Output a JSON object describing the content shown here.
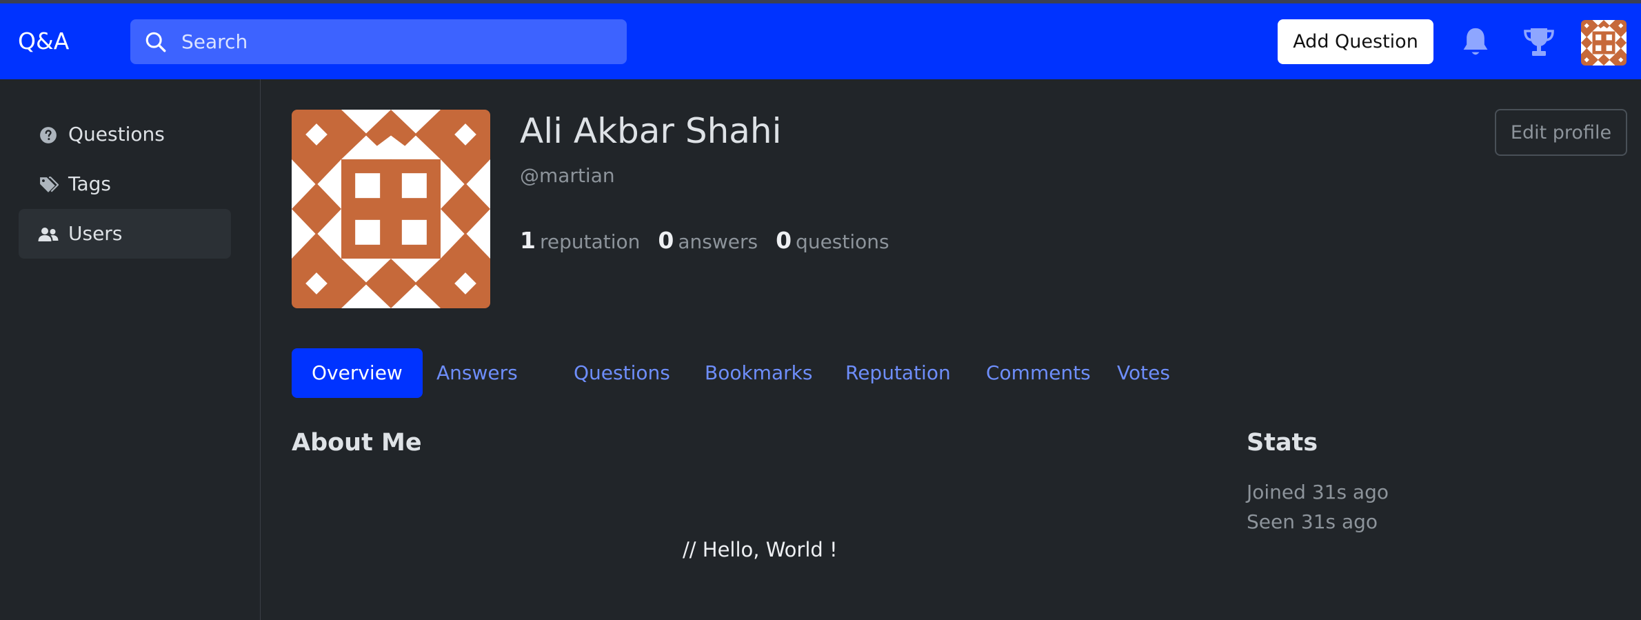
{
  "navbar": {
    "brand": "Q&A",
    "search_placeholder": "Search",
    "add_question_label": "Add Question"
  },
  "sidebar": {
    "items": [
      {
        "label": "Questions",
        "icon": "question-circle-icon"
      },
      {
        "label": "Tags",
        "icon": "tags-icon"
      },
      {
        "label": "Users",
        "icon": "users-icon",
        "active": true
      }
    ]
  },
  "profile": {
    "name": "Ali Akbar Shahi",
    "handle": "@martian",
    "reputation": "1",
    "reputation_label": "reputation",
    "answers": "0",
    "answers_label": "answers",
    "questions": "0",
    "questions_label": "questions",
    "edit_label": "Edit profile",
    "avatar_color": "#c6693a"
  },
  "tabs": [
    "Overview",
    "Answers",
    "Questions",
    "Bookmarks",
    "Reputation",
    "Comments",
    "Votes"
  ],
  "about": {
    "heading": "About Me",
    "text": "// Hello, World !"
  },
  "stats": {
    "heading": "Stats",
    "joined": "Joined 31s ago",
    "seen": "Seen 31s ago"
  },
  "colors": {
    "brand": "#0033ff",
    "background": "#212529",
    "link": "#6e8efb"
  }
}
